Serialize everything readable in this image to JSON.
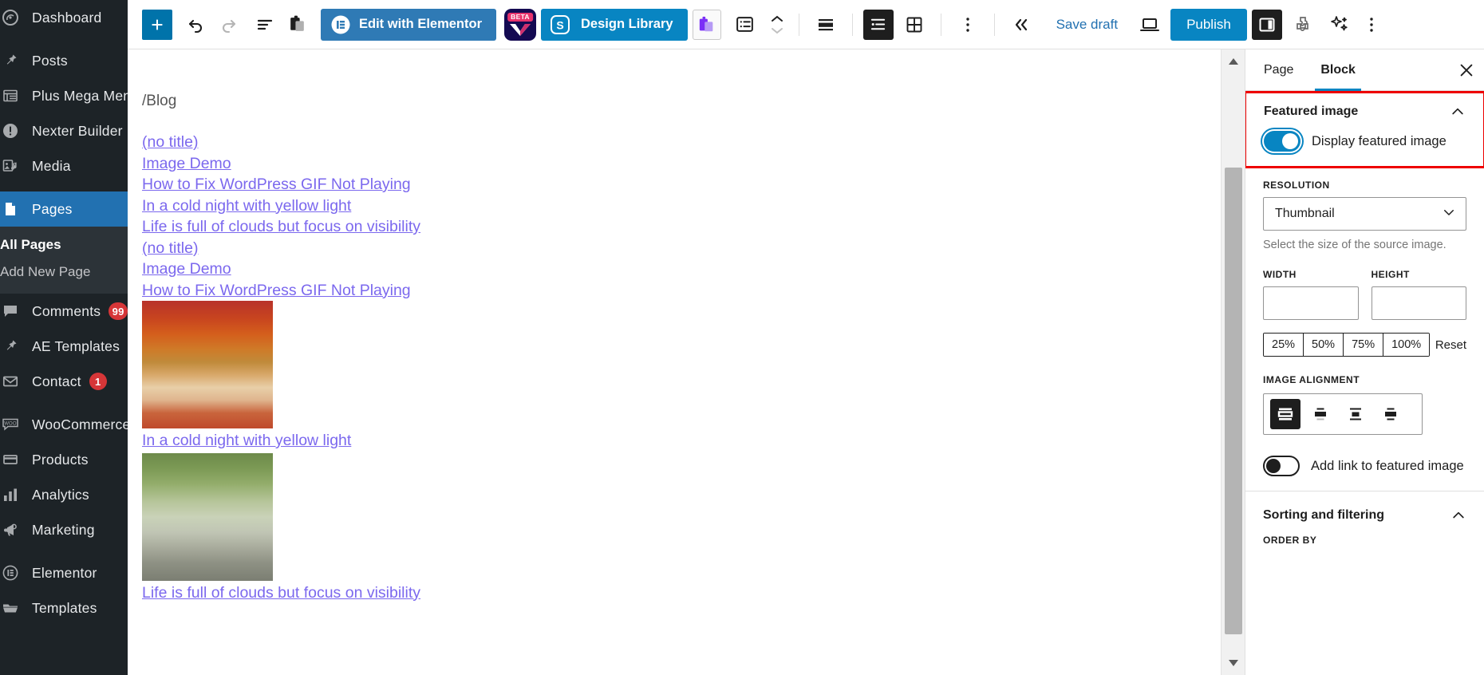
{
  "admin_menu": {
    "items": [
      {
        "label": "Dashboard",
        "icon": "dashboard-icon",
        "current": false,
        "badge": null
      },
      {
        "label": "Posts",
        "icon": "pin-icon",
        "current": false,
        "badge": null
      },
      {
        "label": "Plus Mega Menu",
        "icon": "megamenu-icon",
        "current": false,
        "badge": null
      },
      {
        "label": "Nexter Builder",
        "icon": "exclamation-circle-icon",
        "current": false,
        "badge": null
      },
      {
        "label": "Media",
        "icon": "media-icon",
        "current": false,
        "badge": null
      },
      {
        "label": "Pages",
        "icon": "page-icon",
        "current": true,
        "badge": null
      },
      {
        "label": "Comments",
        "icon": "comment-icon",
        "current": false,
        "badge": "99"
      },
      {
        "label": "AE Templates",
        "icon": "pin-icon",
        "current": false,
        "badge": null
      },
      {
        "label": "Contact",
        "icon": "envelope-icon",
        "current": false,
        "badge": "1"
      },
      {
        "label": "WooCommerce",
        "icon": "woo-icon",
        "current": false,
        "badge": null
      },
      {
        "label": "Products",
        "icon": "products-icon",
        "current": false,
        "badge": null
      },
      {
        "label": "Analytics",
        "icon": "analytics-icon",
        "current": false,
        "badge": null
      },
      {
        "label": "Marketing",
        "icon": "marketing-icon",
        "current": false,
        "badge": null
      },
      {
        "label": "Elementor",
        "icon": "elementor-icon",
        "current": false,
        "badge": null
      },
      {
        "label": "Templates",
        "icon": "folder-icon",
        "current": false,
        "badge": null
      }
    ],
    "submenu": [
      {
        "label": "All Pages",
        "current": true
      },
      {
        "label": "Add New Page",
        "current": false
      }
    ]
  },
  "toolbar": {
    "add_block_label": "+",
    "undo_label": "undo-icon",
    "redo_label": "redo-icon",
    "details_label": "document-overview-icon",
    "copy_label": "copy-icon",
    "elementor_button": "Edit with Elementor",
    "beta_badge": "BETA",
    "design_library_button": "Design Library",
    "list_view_label": "list-view-icon",
    "save_draft": "Save draft",
    "publish": "Publish",
    "preview_label": "preview-icon",
    "settings_label": "settings-sidebar-icon",
    "options_label": "options-icon"
  },
  "canvas": {
    "path": "/Blog",
    "post_links": [
      "(no title)",
      "Image Demo",
      "How to Fix WordPress GIF Not Playing",
      "In a cold night with yellow light",
      "Life is full of clouds but focus on visibility",
      "(no title)",
      "Image Demo",
      "How to Fix WordPress GIF Not Playing"
    ],
    "image_post_1_caption": "In a cold night with yellow light",
    "image_post_2_caption": "Life is full of clouds but focus on visibility",
    "thumb_1_alt": "autumn-forest-path-thumbnail",
    "thumb_2_alt": "misty-green-forest-path-thumbnail"
  },
  "settings": {
    "tabs": [
      {
        "label": "Page",
        "active": false
      },
      {
        "label": "Block",
        "active": true
      }
    ],
    "close_label": "close-icon",
    "featured_image": {
      "title": "Featured image",
      "display_toggle_label": "Display featured image",
      "display_toggle_on": true,
      "resolution_label": "RESOLUTION",
      "resolution_value": "Thumbnail",
      "resolution_help": "Select the size of the source image.",
      "width_label": "WIDTH",
      "width_value": "",
      "height_label": "HEIGHT",
      "height_value": "",
      "percent_options": [
        "25%",
        "50%",
        "75%",
        "100%"
      ],
      "reset_label": "Reset",
      "alignment_label": "IMAGE ALIGNMENT",
      "alignment_options": [
        "align-none",
        "align-top",
        "align-middle",
        "align-bottom"
      ],
      "alignment_selected": 0,
      "add_link_label": "Add link to featured image",
      "add_link_on": false
    },
    "sorting": {
      "title": "Sorting and filtering",
      "order_by_label": "ORDER BY"
    }
  },
  "colors": {
    "admin_bg": "#1d2327",
    "admin_current": "#2271b1",
    "accent_blue": "#0885c2",
    "highlight_red": "#ee0000",
    "link_purple": "#7b68ee",
    "badge_red": "#d63638"
  }
}
